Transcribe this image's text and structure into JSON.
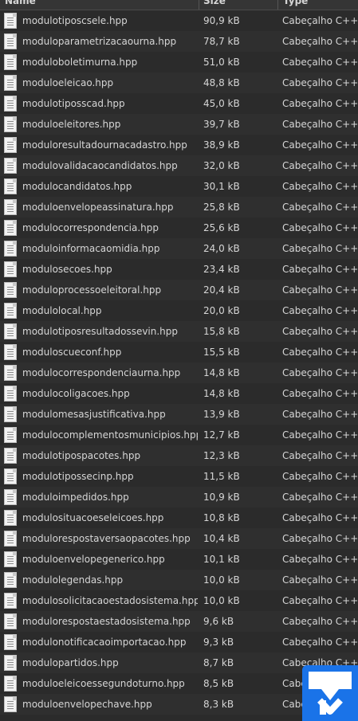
{
  "header": {
    "name": "Name",
    "size": "Size",
    "type": "Type"
  },
  "rows": [
    {
      "name": "modulotiposcsele.hpp",
      "size": "90,9 kB",
      "type": "Cabeçalho C++"
    },
    {
      "name": "moduloparametrizacaourna.hpp",
      "size": "78,7 kB",
      "type": "Cabeçalho C++"
    },
    {
      "name": "moduloboletimurna.hpp",
      "size": "51,0 kB",
      "type": "Cabeçalho C++"
    },
    {
      "name": "moduloeleicao.hpp",
      "size": "48,8 kB",
      "type": "Cabeçalho C++"
    },
    {
      "name": "modulotiposscad.hpp",
      "size": "45,0 kB",
      "type": "Cabeçalho C++"
    },
    {
      "name": "moduloeleitores.hpp",
      "size": "39,7 kB",
      "type": "Cabeçalho C++"
    },
    {
      "name": "moduloresultadournacadastro.hpp",
      "size": "38,9 kB",
      "type": "Cabeçalho C++"
    },
    {
      "name": "modulovalidacaocandidatos.hpp",
      "size": "32,0 kB",
      "type": "Cabeçalho C++"
    },
    {
      "name": "modulocandidatos.hpp",
      "size": "30,1 kB",
      "type": "Cabeçalho C++"
    },
    {
      "name": "moduloenvelopeassinatura.hpp",
      "size": "25,8 kB",
      "type": "Cabeçalho C++"
    },
    {
      "name": "modulocorrespondencia.hpp",
      "size": "25,6 kB",
      "type": "Cabeçalho C++"
    },
    {
      "name": "moduloinformacaomidia.hpp",
      "size": "24,0 kB",
      "type": "Cabeçalho C++"
    },
    {
      "name": "modulosecoes.hpp",
      "size": "23,4 kB",
      "type": "Cabeçalho C++"
    },
    {
      "name": "moduloprocessoeleitoral.hpp",
      "size": "20,4 kB",
      "type": "Cabeçalho C++"
    },
    {
      "name": "modulolocal.hpp",
      "size": "20,0 kB",
      "type": "Cabeçalho C++"
    },
    {
      "name": "modulotiposresultadossevin.hpp",
      "size": "15,8 kB",
      "type": "Cabeçalho C++"
    },
    {
      "name": "moduloscueconf.hpp",
      "size": "15,5 kB",
      "type": "Cabeçalho C++"
    },
    {
      "name": "modulocorrespondenciaurna.hpp",
      "size": "14,8 kB",
      "type": "Cabeçalho C++"
    },
    {
      "name": "modulocoligacoes.hpp",
      "size": "14,8 kB",
      "type": "Cabeçalho C++"
    },
    {
      "name": "modulomesasjustificativa.hpp",
      "size": "13,9 kB",
      "type": "Cabeçalho C++"
    },
    {
      "name": "modulocomplementosmunicipios.hpp",
      "size": "12,7 kB",
      "type": "Cabeçalho C++"
    },
    {
      "name": "modulotipospacotes.hpp",
      "size": "12,3 kB",
      "type": "Cabeçalho C++"
    },
    {
      "name": "modulotipossecinp.hpp",
      "size": "11,5 kB",
      "type": "Cabeçalho C++"
    },
    {
      "name": "moduloimpedidos.hpp",
      "size": "10,9 kB",
      "type": "Cabeçalho C++"
    },
    {
      "name": "modulosituacoeseleicoes.hpp",
      "size": "10,8 kB",
      "type": "Cabeçalho C++"
    },
    {
      "name": "modulorespostaversaopacotes.hpp",
      "size": "10,4 kB",
      "type": "Cabeçalho C++"
    },
    {
      "name": "moduloenvelopegenerico.hpp",
      "size": "10,1 kB",
      "type": "Cabeçalho C++"
    },
    {
      "name": "modulolegendas.hpp",
      "size": "10,0 kB",
      "type": "Cabeçalho C++"
    },
    {
      "name": "modulosolicitacaoestadosistema.hpp",
      "size": "10,0 kB",
      "type": "Cabeçalho C++"
    },
    {
      "name": "modulorespostaestadosistema.hpp",
      "size": "9,6 kB",
      "type": "Cabeçalho C++"
    },
    {
      "name": "modulonotificacaoimportacao.hpp",
      "size": "9,3 kB",
      "type": "Cabeçalho C++"
    },
    {
      "name": "modulopartidos.hpp",
      "size": "8,7 kB",
      "type": "Cabeçalho C++"
    },
    {
      "name": "moduloeleicoessegundoturno.hpp",
      "size": "8,5 kB",
      "type": "Cabe"
    },
    {
      "name": "moduloenvelopechave.hpp",
      "size": "8,3 kB",
      "type": "Cabe"
    }
  ],
  "colors": {
    "background": "#2b2b2b",
    "text": "#d6d6d6",
    "badge": "#1a73e8"
  },
  "icons": {
    "file": "text-file-icon",
    "badge": "download-badge-icon"
  }
}
